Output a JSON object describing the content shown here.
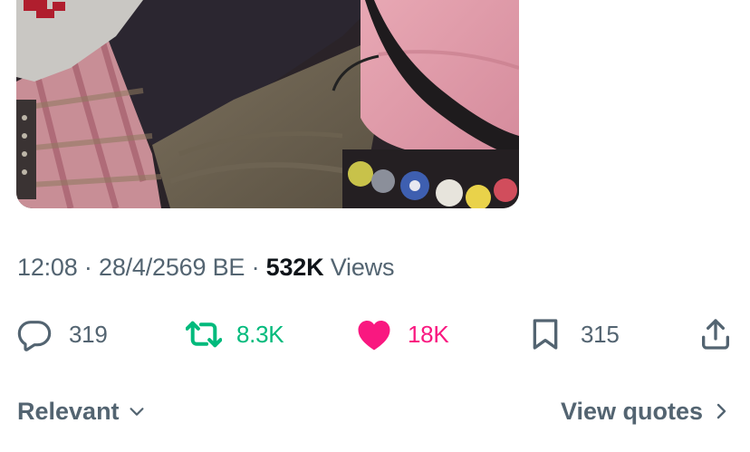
{
  "tweet": {
    "time": "12:08",
    "date": "28/4/2569 BE",
    "separator": "·",
    "views_count": "532K",
    "views_label": "Views"
  },
  "actions": {
    "replies": "319",
    "reposts": "8.3K",
    "likes": "18K",
    "bookmarks": "315"
  },
  "replies_section": {
    "sort_label": "Relevant",
    "view_quotes_label": "View quotes"
  },
  "colors": {
    "text_secondary": "#536471",
    "text_primary": "#0f1419",
    "repost_active": "#00ba7c",
    "like_active": "#f91880"
  },
  "icons": {
    "reply": "speech-bubble-icon",
    "repost": "repost-arrows-icon",
    "like": "heart-icon",
    "bookmark": "bookmark-icon",
    "share": "share-upload-icon",
    "sort": "chevron-down-icon",
    "quotes": "chevron-right-icon"
  }
}
